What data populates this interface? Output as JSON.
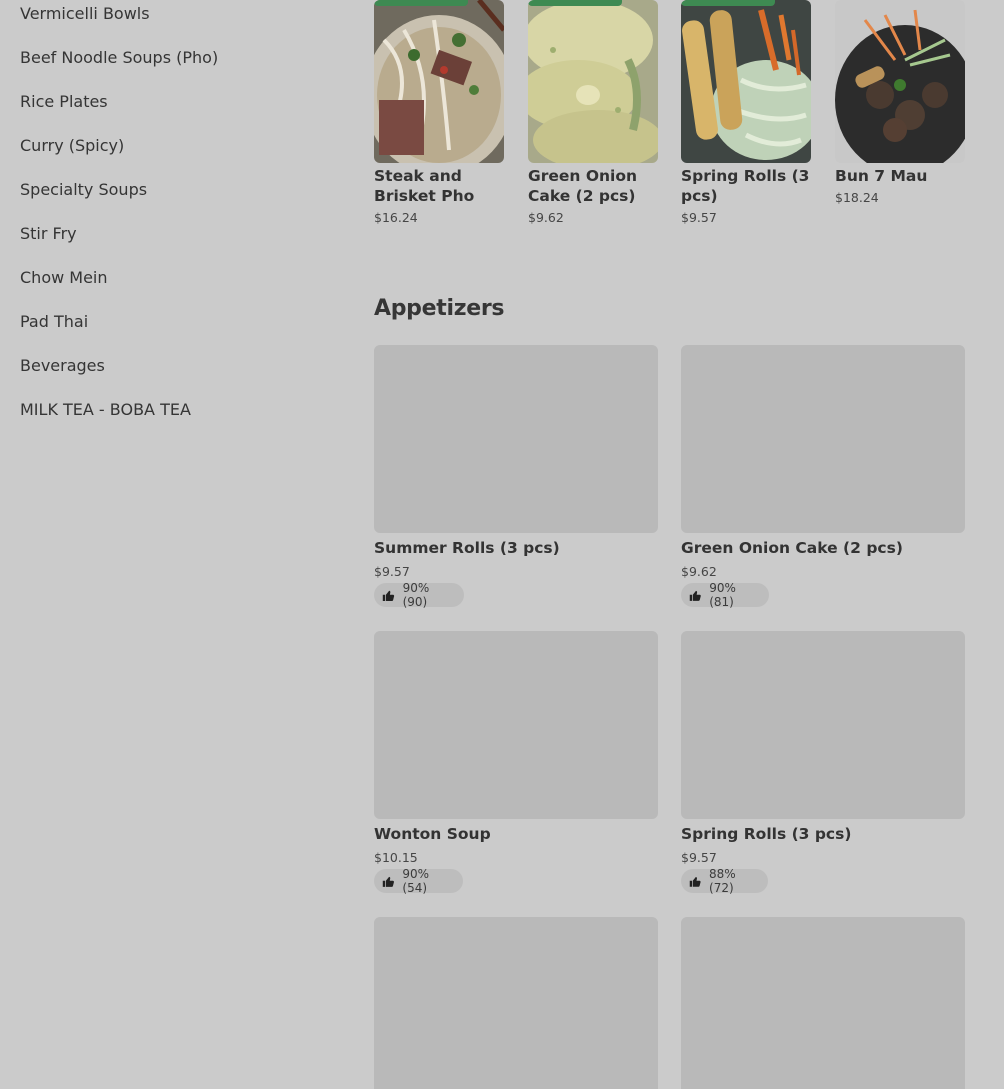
{
  "sidebar": {
    "items": [
      {
        "label": "Vermicelli Bowls"
      },
      {
        "label": "Beef Noodle Soups (Pho)"
      },
      {
        "label": "Rice Plates"
      },
      {
        "label": "Curry (Spicy)"
      },
      {
        "label": "Specialty Soups"
      },
      {
        "label": "Stir Fry"
      },
      {
        "label": "Chow Mein"
      },
      {
        "label": "Pad Thai"
      },
      {
        "label": "Beverages"
      },
      {
        "label": "MILK TEA - BOBA TEA"
      }
    ]
  },
  "featured": [
    {
      "name": "Steak and Brisket Pho",
      "price": "$16.24",
      "icon": "pho-bowl-photo"
    },
    {
      "name": "Green Onion Cake (2 pcs)",
      "price": "$9.62",
      "icon": "green-onion-cake-photo"
    },
    {
      "name": "Spring Rolls (3 pcs)",
      "price": "$9.57",
      "icon": "spring-rolls-photo"
    },
    {
      "name": "Bun 7 Mau",
      "price": "$18.24",
      "icon": "bun-7-mau-photo"
    }
  ],
  "appetizers": {
    "title": "Appetizers",
    "items": [
      {
        "name": "Summer Rolls (3 pcs)",
        "price": "$9.57",
        "rating": "90% (90)"
      },
      {
        "name": "Green Onion Cake (2 pcs)",
        "price": "$9.62",
        "rating": "90% (81)"
      },
      {
        "name": "Wonton Soup",
        "price": "$10.15",
        "rating": "90% (54)"
      },
      {
        "name": "Spring Rolls (3 pcs)",
        "price": "$9.57",
        "rating": "88% (72)"
      },
      {
        "name": "",
        "price": "",
        "rating": ""
      },
      {
        "name": "",
        "price": "",
        "rating": ""
      }
    ]
  },
  "colors": {
    "background": "#cbcbcb",
    "placeholder": "#b9b9b9",
    "badge": "#3e8a52"
  }
}
